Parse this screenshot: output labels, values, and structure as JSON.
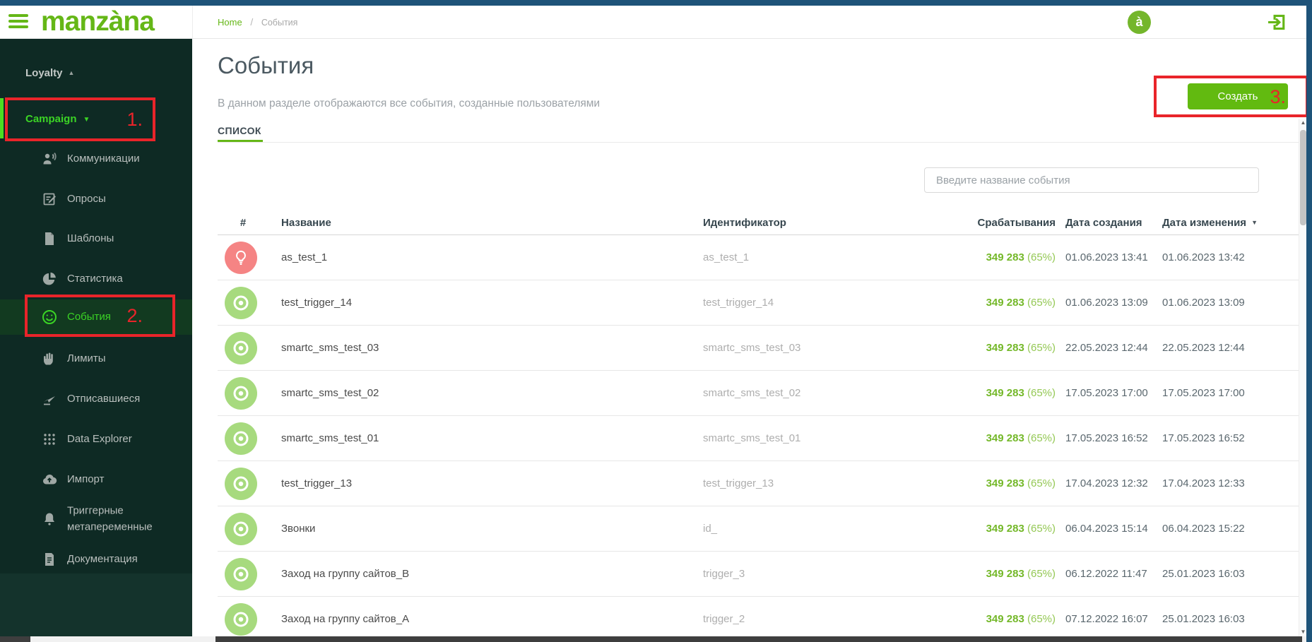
{
  "header": {
    "logo": "manzàna",
    "breadcrumb": {
      "home": "Home",
      "separator": "/",
      "current": "События"
    },
    "avatar_initial": "à"
  },
  "icons": {
    "caret_up": "▲",
    "caret_down": "▼",
    "sort_desc": "▼"
  },
  "sidebar": {
    "section_label": "Loyalty",
    "campaign_label": "Campaign",
    "items": [
      {
        "label": "Коммуникации",
        "icon": "communications-icon"
      },
      {
        "label": "Опросы",
        "icon": "surveys-icon"
      },
      {
        "label": "Шаблоны",
        "icon": "templates-icon"
      },
      {
        "label": "Статистика",
        "icon": "statistics-icon"
      },
      {
        "label": "События",
        "icon": "events-smiley-icon",
        "active": true
      },
      {
        "label": "Лимиты",
        "icon": "limits-hand-icon"
      },
      {
        "label": "Отписавшиеся",
        "icon": "unsubscribed-icon"
      },
      {
        "label": "Data Explorer",
        "icon": "data-explorer-grid-icon"
      },
      {
        "label": "Импорт",
        "icon": "import-cloud-icon"
      },
      {
        "label": "Триггерные метапеременные",
        "icon": "trigger-bell-icon"
      },
      {
        "label": "Документация",
        "icon": "documentation-icon"
      }
    ]
  },
  "annotations": {
    "step1": "1.",
    "step2": "2.",
    "step3": "3."
  },
  "page": {
    "title": "События",
    "subtitle": "В данном разделе отображаются все события, созданные пользователями",
    "tab_label": "СПИСОК",
    "create_button": "Создать",
    "search_placeholder": "Введите название события"
  },
  "table": {
    "headers": {
      "number": "#",
      "name": "Название",
      "identifier": "Идентификатор",
      "triggers": "Срабатывания",
      "created": "Дата создания",
      "modified": "Дата изменения"
    },
    "rows": [
      {
        "icon": "bulb-icon",
        "name": "as_test_1",
        "identifier": "as_test_1",
        "triggers": "349 283",
        "percent": "(65%)",
        "created": "01.06.2023 13:41",
        "modified": "01.06.2023 13:42"
      },
      {
        "icon": "target-icon",
        "name": "test_trigger_14",
        "identifier": "test_trigger_14",
        "triggers": "349 283",
        "percent": "(65%)",
        "created": "01.06.2023 13:09",
        "modified": "01.06.2023 13:09"
      },
      {
        "icon": "target-icon",
        "name": "smartc_sms_test_03",
        "identifier": "smartc_sms_test_03",
        "triggers": "349 283",
        "percent": "(65%)",
        "created": "22.05.2023 12:44",
        "modified": "22.05.2023 12:44"
      },
      {
        "icon": "target-icon",
        "name": "smartc_sms_test_02",
        "identifier": "smartc_sms_test_02",
        "triggers": "349 283",
        "percent": "(65%)",
        "created": "17.05.2023 17:00",
        "modified": "17.05.2023 17:00"
      },
      {
        "icon": "target-icon",
        "name": "smartc_sms_test_01",
        "identifier": "smartc_sms_test_01",
        "triggers": "349 283",
        "percent": "(65%)",
        "created": "17.05.2023 16:52",
        "modified": "17.05.2023 16:52"
      },
      {
        "icon": "target-icon",
        "name": "test_trigger_13",
        "identifier": "test_trigger_13",
        "triggers": "349 283",
        "percent": "(65%)",
        "created": "17.04.2023 12:32",
        "modified": "17.04.2023 12:33"
      },
      {
        "icon": "target-icon",
        "name": "Звонки",
        "identifier": "id_",
        "triggers": "349 283",
        "percent": "(65%)",
        "created": "06.04.2023 15:14",
        "modified": "06.04.2023 15:22"
      },
      {
        "icon": "target-icon",
        "name": "Заход на группу сайтов_B",
        "identifier": "trigger_3",
        "triggers": "349 283",
        "percent": "(65%)",
        "created": "06.12.2022 11:47",
        "modified": "25.01.2023 16:03"
      },
      {
        "icon": "target-icon",
        "name": "Заход на группу сайтов_A",
        "identifier": "trigger_2",
        "triggers": "349 283",
        "percent": "(65%)",
        "created": "07.12.2022 16:07",
        "modified": "25.01.2023 16:03"
      }
    ]
  },
  "colors": {
    "brand_green": "#65b717",
    "button_green": "#62ba10",
    "sidebar_active_green": "#3bd425",
    "annotation_red": "#e9242a",
    "frame_blue": "#1e5379",
    "sidebar_bg": "#0e2a24",
    "trigger_green": "#74b829",
    "row_icon_green": "#a7da7e",
    "row_icon_salmon": "#f58484"
  }
}
